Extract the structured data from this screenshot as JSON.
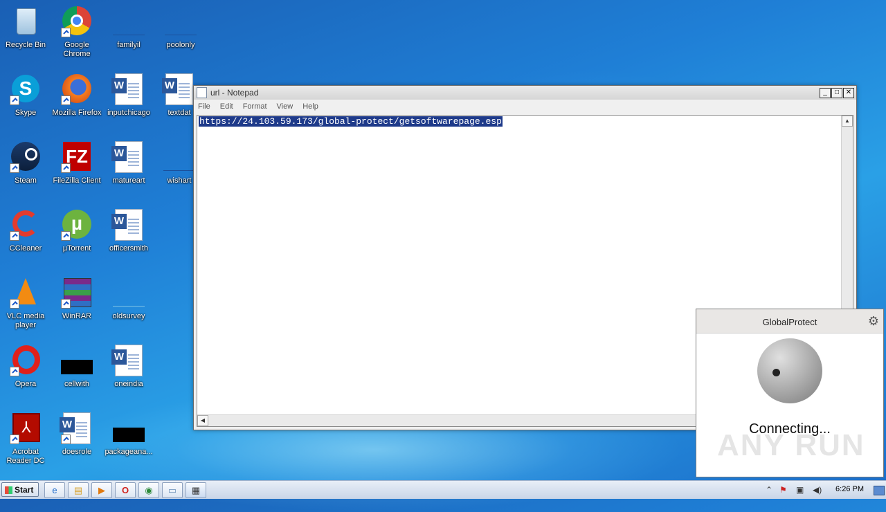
{
  "desktop_icons": [
    {
      "label": "Recycle Bin",
      "name": "recycle-bin-icon"
    },
    {
      "label": "Google Chrome",
      "name": "chrome-icon"
    },
    {
      "label": "familyil",
      "name": "file-icon"
    },
    {
      "label": "poolonly",
      "name": "file-icon"
    },
    {
      "label": "Skype",
      "name": "skype-icon"
    },
    {
      "label": "Mozilla Firefox",
      "name": "firefox-icon"
    },
    {
      "label": "inputchicago",
      "name": "word-doc-icon"
    },
    {
      "label": "textdat",
      "name": "word-doc-icon"
    },
    {
      "label": "Steam",
      "name": "steam-icon"
    },
    {
      "label": "FileZilla Client",
      "name": "filezilla-icon"
    },
    {
      "label": "matureart",
      "name": "word-doc-icon"
    },
    {
      "label": "wishart",
      "name": "file-icon"
    },
    {
      "label": "CCleaner",
      "name": "ccleaner-icon"
    },
    {
      "label": "µTorrent",
      "name": "utorrent-icon"
    },
    {
      "label": "officersmith",
      "name": "word-doc-icon"
    },
    {
      "label": "VLC media player",
      "name": "vlc-icon"
    },
    {
      "label": "WinRAR",
      "name": "winrar-icon"
    },
    {
      "label": "oldsurvey",
      "name": "file-icon"
    },
    {
      "label": "Opera",
      "name": "opera-icon"
    },
    {
      "label": "cellwith",
      "name": "file-icon"
    },
    {
      "label": "oneindia",
      "name": "word-doc-icon"
    },
    {
      "label": "Acrobat Reader DC",
      "name": "acrobat-icon"
    },
    {
      "label": "doesrole",
      "name": "word-doc-icon"
    },
    {
      "label": "packageana...",
      "name": "file-icon"
    }
  ],
  "notepad": {
    "title": "url - Notepad",
    "menu": [
      "File",
      "Edit",
      "Format",
      "View",
      "Help"
    ],
    "content": "https://24.103.59.173/global-protect/getsoftwarepage.esp",
    "buttons": {
      "min": "_",
      "max": "□",
      "close": "✕"
    }
  },
  "globalprotect": {
    "title": "GlobalProtect",
    "status": "Connecting..."
  },
  "taskbar": {
    "start_label": "Start",
    "clock": "6:26 PM"
  },
  "watermark": "ANY RUN"
}
